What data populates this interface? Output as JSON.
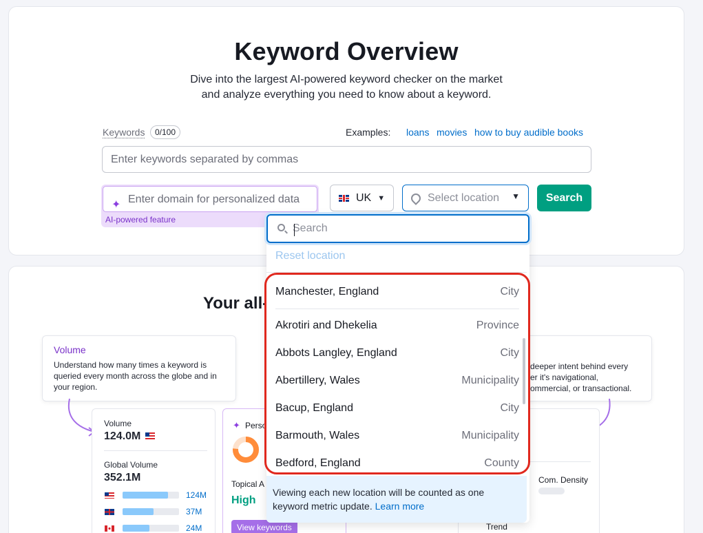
{
  "header": {
    "title": "Keyword Overview",
    "subtitle_line1": "Dive into the largest AI-powered keyword checker on the market",
    "subtitle_line2": "and analyze everything you need to know about a keyword."
  },
  "form": {
    "keywords_label": "Keywords",
    "keywords_count": "0/100",
    "examples_label": "Examples:",
    "examples": [
      "loans",
      "movies",
      "how to buy audible books"
    ],
    "keywords_placeholder": "Enter keywords separated by commas",
    "domain_placeholder": "Enter domain for personalized data",
    "ai_note": "AI-powered feature",
    "database": "UK",
    "location_placeholder": "Select location",
    "search_button": "Search"
  },
  "location_dropdown": {
    "search_placeholder": "Search",
    "reset_label": "Reset location",
    "items": [
      {
        "name": "Manchester, England",
        "type": "City"
      },
      {
        "name": "Akrotiri and Dhekelia",
        "type": "Province"
      },
      {
        "name": "Abbots Langley, England",
        "type": "City"
      },
      {
        "name": "Abertillery, Wales",
        "type": "Municipality"
      },
      {
        "name": "Bacup, England",
        "type": "City"
      },
      {
        "name": "Barmouth, Wales",
        "type": "Municipality"
      },
      {
        "name": "Bedford, England",
        "type": "County"
      }
    ],
    "note_text": "Viewing each new location will be counted as one keyword metric update.",
    "note_link": "Learn more"
  },
  "showcase": {
    "title_visible": "Your all-",
    "volume_tip": {
      "title": "Volume",
      "body": "Understand how many times a keyword is queried every month across the globe and in your region."
    },
    "intent_tip_body_lines": [
      "deeper intent behind every",
      "er it's navigational,",
      "ommercial, or transactional."
    ],
    "volume_panel": {
      "volume_label": "Volume",
      "volume_value": "124.0M",
      "global_label": "Global Volume",
      "global_value": "352.1M",
      "bars": [
        {
          "country": "US",
          "value": "124M",
          "fill": 0.8
        },
        {
          "country": "UK",
          "value": "37M",
          "fill": 0.55
        },
        {
          "country": "CA",
          "value": "24M",
          "fill": 0.48
        }
      ]
    },
    "personal_panel": {
      "label_partial": "Perso",
      "topical_partial": "Topical A",
      "topical_value": "High",
      "button": "View keywords"
    },
    "right_panel": {
      "badge_partial": "al",
      "com_density": "Com. Density",
      "trend_partial": "Trend"
    }
  },
  "colors": {
    "accent_green": "#009f81",
    "link_blue": "#006dca",
    "ai_purple": "#7a32c9",
    "highlight_red": "#e0281e"
  }
}
